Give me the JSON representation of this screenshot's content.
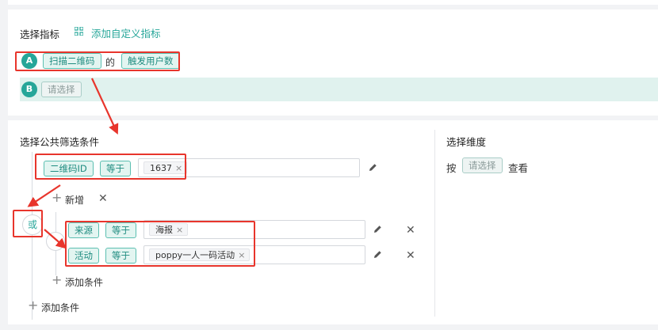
{
  "metrics_section": {
    "title": "选择指标",
    "add_custom_link": "添加自定义指标",
    "rows": [
      {
        "badge": "A",
        "event": "扫描二维码",
        "connector": "的",
        "metric": "触发用户数"
      },
      {
        "badge": "B",
        "placeholder": "请选择"
      }
    ]
  },
  "filter_section": {
    "title": "选择公共筛选条件",
    "conditions": [
      {
        "field": "二维码ID",
        "operator": "等于",
        "value": "1637"
      }
    ],
    "add_new_label": "新增",
    "or_label": "或",
    "or_group": [
      {
        "field": "来源",
        "operator": "等于",
        "value": "海报"
      },
      {
        "field": "活动",
        "operator": "等于",
        "value": "poppy一人一码活动"
      }
    ],
    "group_add_condition": "添加条件",
    "add_condition": "添加条件"
  },
  "dimension_section": {
    "title": "选择维度",
    "prefix": "按",
    "placeholder": "请选择",
    "suffix": "查看"
  },
  "icons": {
    "custom_metric_icon": "grid-icon",
    "edit_icon": "pencil-icon",
    "close_icon": "x-icon",
    "add_icon": "plus-icon"
  },
  "colors": {
    "accent": "#26a699",
    "tag_bg": "#e3f5f1",
    "highlight_row": "#e0f2ee",
    "annotation": "#e8352c"
  }
}
